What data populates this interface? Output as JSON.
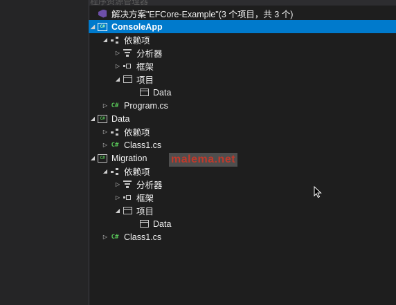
{
  "top_strip_text": "程序资源管理器",
  "solution": {
    "label": "解决方案\"EFCore-Example\"(3 个项目，共 3 个)"
  },
  "tree": [
    {
      "label": "ConsoleApp",
      "icon": "csharp-project-icon",
      "expander": "expanded"
    },
    {
      "label": "依赖项",
      "icon": "dependencies-icon",
      "expander": "expanded"
    },
    {
      "label": "分析器",
      "icon": "analyzer-icon",
      "expander": "collapsed"
    },
    {
      "label": "框架",
      "icon": "framework-icon",
      "expander": "collapsed"
    },
    {
      "label": "项目",
      "icon": "project-ref-icon",
      "expander": "expanded"
    },
    {
      "label": "Data",
      "icon": "project-ref-icon",
      "expander": "none"
    },
    {
      "label": "Program.cs",
      "icon": "csharp-file-icon",
      "badge": "C#",
      "expander": "collapsed"
    },
    {
      "label": "Data",
      "icon": "csharp-project-icon",
      "expander": "expanded"
    },
    {
      "label": "依赖项",
      "icon": "dependencies-icon",
      "expander": "collapsed"
    },
    {
      "label": "Class1.cs",
      "icon": "csharp-file-icon",
      "badge": "C#",
      "expander": "collapsed"
    },
    {
      "label": "Migration",
      "icon": "csharp-project-icon",
      "expander": "expanded"
    },
    {
      "label": "依赖项",
      "icon": "dependencies-icon",
      "expander": "expanded"
    },
    {
      "label": "分析器",
      "icon": "analyzer-icon",
      "expander": "collapsed"
    },
    {
      "label": "框架",
      "icon": "framework-icon",
      "expander": "collapsed"
    },
    {
      "label": "项目",
      "icon": "project-ref-icon",
      "expander": "expanded"
    },
    {
      "label": "Data",
      "icon": "project-ref-icon",
      "expander": "none"
    },
    {
      "label": "Class1.cs",
      "icon": "csharp-file-icon",
      "badge": "C#",
      "expander": "collapsed"
    }
  ],
  "project_badge": "C#",
  "watermark": "malema.net",
  "colors": {
    "selection": "#007acc",
    "background": "#1e1e1e",
    "csharp_green": "#57c457",
    "solution_purple": "#6d4fa9"
  }
}
